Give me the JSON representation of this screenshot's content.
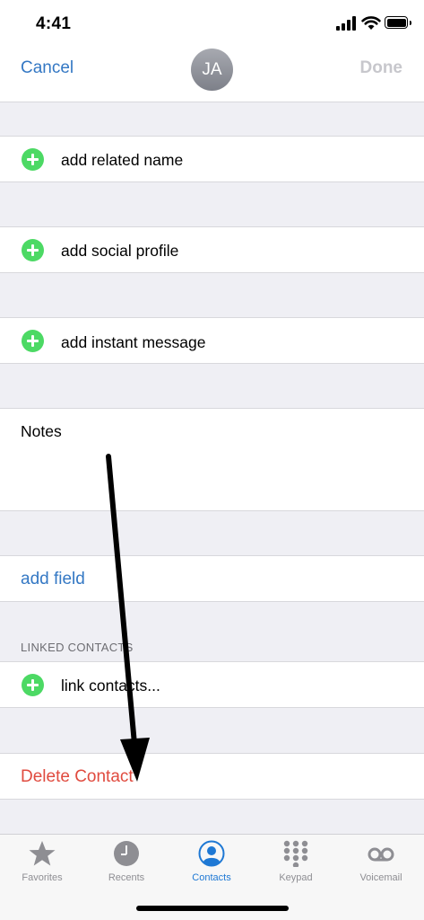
{
  "status_bar": {
    "time": "4:41"
  },
  "nav": {
    "cancel": "Cancel",
    "avatar_initials": "JA",
    "done": "Done"
  },
  "fields": {
    "related_name": "add related name",
    "social_profile": "add social profile",
    "instant_message": "add instant message",
    "notes_label": "Notes",
    "add_field": "add field"
  },
  "linked_contacts": {
    "header": "LINKED CONTACTS",
    "link_label": "link contacts..."
  },
  "delete": {
    "label": "Delete Contact"
  },
  "tabs": [
    {
      "label": "Favorites",
      "icon": "star-icon",
      "active": false
    },
    {
      "label": "Recents",
      "icon": "clock-icon",
      "active": false
    },
    {
      "label": "Contacts",
      "icon": "person-circle-icon",
      "active": true
    },
    {
      "label": "Keypad",
      "icon": "keypad-icon",
      "active": false
    },
    {
      "label": "Voicemail",
      "icon": "voicemail-icon",
      "active": false
    }
  ],
  "colors": {
    "accent_blue": "#3478c4",
    "add_green": "#4cd964",
    "delete_red": "#e04b3f",
    "background": "#efeff4",
    "tab_active": "#1e78d4",
    "tab_inactive": "#8e8e93",
    "annotation_arrow": "#000000"
  }
}
